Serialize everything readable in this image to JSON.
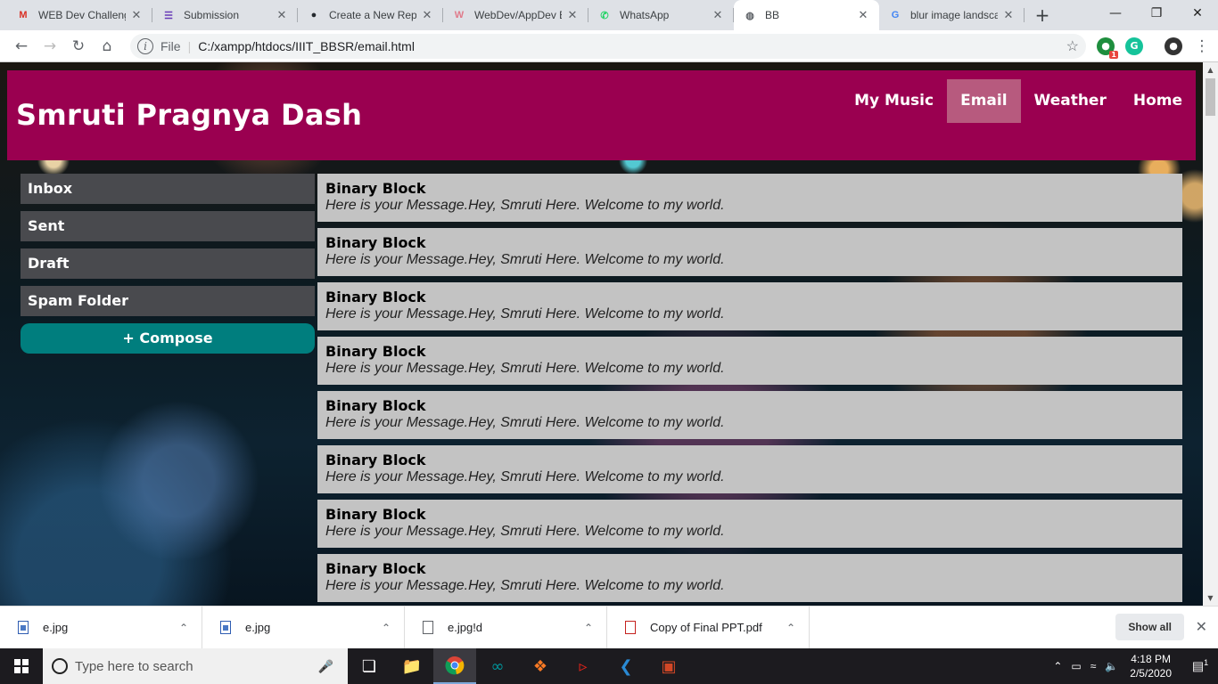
{
  "browser": {
    "tabs": [
      {
        "title": "WEB Dev Challenge",
        "favicon": "gmail-icon",
        "color": "#d93025",
        "glyph": "M"
      },
      {
        "title": "Submission",
        "favicon": "forms-icon",
        "color": "#673ab7",
        "glyph": "☰"
      },
      {
        "title": "Create a New Repo",
        "favicon": "github-icon",
        "color": "#24292e",
        "glyph": "●"
      },
      {
        "title": "WebDev/AppDev E",
        "favicon": "w-icon",
        "color": "#e07a8a",
        "glyph": "W"
      },
      {
        "title": "WhatsApp",
        "favicon": "whatsapp-icon",
        "color": "#25d366",
        "glyph": "✆"
      },
      {
        "title": "BB",
        "favicon": "globe-icon",
        "color": "#5f6368",
        "glyph": "◍",
        "active": true
      },
      {
        "title": "blur image landsca",
        "favicon": "google-icon",
        "color": "#4285f4",
        "glyph": "G"
      }
    ],
    "scheme": "File",
    "url": "C:/xampp/htdocs/IIIT_BBSR/email.html",
    "ext_badge": "1"
  },
  "site": {
    "title": "Smruti Pragnya Dash",
    "nav": [
      {
        "label": "My Music"
      },
      {
        "label": "Email",
        "active": true
      },
      {
        "label": "Weather"
      },
      {
        "label": "Home"
      }
    ]
  },
  "sidebar": {
    "items": [
      "Inbox",
      "Sent",
      "Draft",
      "Spam Folder"
    ],
    "compose": "+ Compose"
  },
  "messages": [
    {
      "sender": "Binary Block",
      "body": "Here is your Message.Hey, Smruti Here. Welcome to my world."
    },
    {
      "sender": "Binary Block",
      "body": "Here is your Message.Hey, Smruti Here. Welcome to my world."
    },
    {
      "sender": "Binary Block",
      "body": "Here is your Message.Hey, Smruti Here. Welcome to my world."
    },
    {
      "sender": "Binary Block",
      "body": "Here is your Message.Hey, Smruti Here. Welcome to my world."
    },
    {
      "sender": "Binary Block",
      "body": "Here is your Message.Hey, Smruti Here. Welcome to my world."
    },
    {
      "sender": "Binary Block",
      "body": "Here is your Message.Hey, Smruti Here. Welcome to my world."
    },
    {
      "sender": "Binary Block",
      "body": "Here is your Message.Hey, Smruti Here. Welcome to my world."
    },
    {
      "sender": "Binary Block",
      "body": "Here is your Message.Hey, Smruti Here. Welcome to my world."
    }
  ],
  "downloads": {
    "items": [
      {
        "name": "e.jpg",
        "type": "img"
      },
      {
        "name": "e.jpg",
        "type": "img"
      },
      {
        "name": "e.jpg!d",
        "type": "file"
      },
      {
        "name": "Copy of Final PPT.pdf",
        "type": "pdf"
      }
    ],
    "show_all": "Show all"
  },
  "taskbar": {
    "search_placeholder": "Type here to search",
    "time": "4:18 PM",
    "date": "2/5/2020",
    "notification_count": "1"
  },
  "colors": {
    "header": "#9a0050",
    "nav_active": "#b75a7e",
    "sidebar_item": "#494a4e",
    "compose": "#007e7e",
    "message_bg": "#c3c3c3"
  }
}
